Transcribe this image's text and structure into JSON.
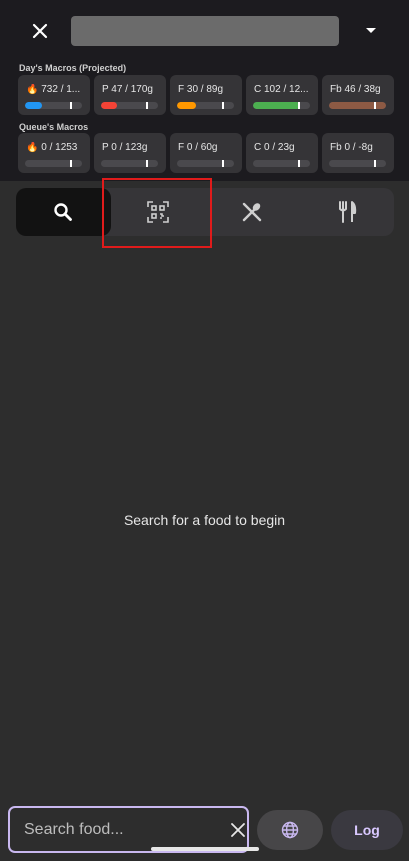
{
  "header": {
    "close_icon": "close-icon",
    "dropdown_icon": "arrow-drop-down-icon"
  },
  "days_macros": {
    "label": "Day's Macros (Projected)",
    "cards": [
      {
        "text": "🔥 732 / 1...",
        "fill": 0.3,
        "color": "#2196f3",
        "target": 0.79
      },
      {
        "text": "P 47 / 170g",
        "fill": 0.28,
        "color": "#f44336",
        "target": 0.79
      },
      {
        "text": "F 30 / 89g",
        "fill": 0.34,
        "color": "#ff9800",
        "target": 0.79
      },
      {
        "text": "C 102 / 12...",
        "fill": 0.82,
        "color": "#4caf50",
        "target": 0.79
      },
      {
        "text": "Fb 46 / 38g",
        "fill": 1.0,
        "color": "#8d5a44",
        "target": 0.79
      }
    ]
  },
  "queue_macros": {
    "label": "Queue's Macros",
    "cards": [
      {
        "text": "🔥 0 / 1253",
        "fill": 0,
        "color": "#2196f3",
        "target": 0.79
      },
      {
        "text": "P 0 / 123g",
        "fill": 0,
        "color": "#f44336",
        "target": 0.79
      },
      {
        "text": "F 0 / 60g",
        "fill": 0,
        "color": "#ff9800",
        "target": 0.79
      },
      {
        "text": "C 0 / 23g",
        "fill": 0,
        "color": "#4caf50",
        "target": 0.79
      },
      {
        "text": "Fb 0 / -8g",
        "fill": 0,
        "color": "#8d5a44",
        "target": 0.79
      }
    ]
  },
  "mode_tabs": [
    {
      "icon": "search-icon",
      "active": true
    },
    {
      "icon": "qr-scan-icon",
      "active": false
    },
    {
      "icon": "spoon-knife-icon",
      "active": false
    },
    {
      "icon": "restaurant-icon",
      "active": false
    }
  ],
  "main": {
    "empty_message": "Search for a food to begin"
  },
  "bottom": {
    "search_placeholder": "Search food...",
    "search_value": "",
    "clear_icon": "close-icon",
    "globe_icon": "globe-icon",
    "log_label": "Log"
  },
  "colors": {
    "accent": "#c9b8f0",
    "highlight": "#e01b1b"
  }
}
